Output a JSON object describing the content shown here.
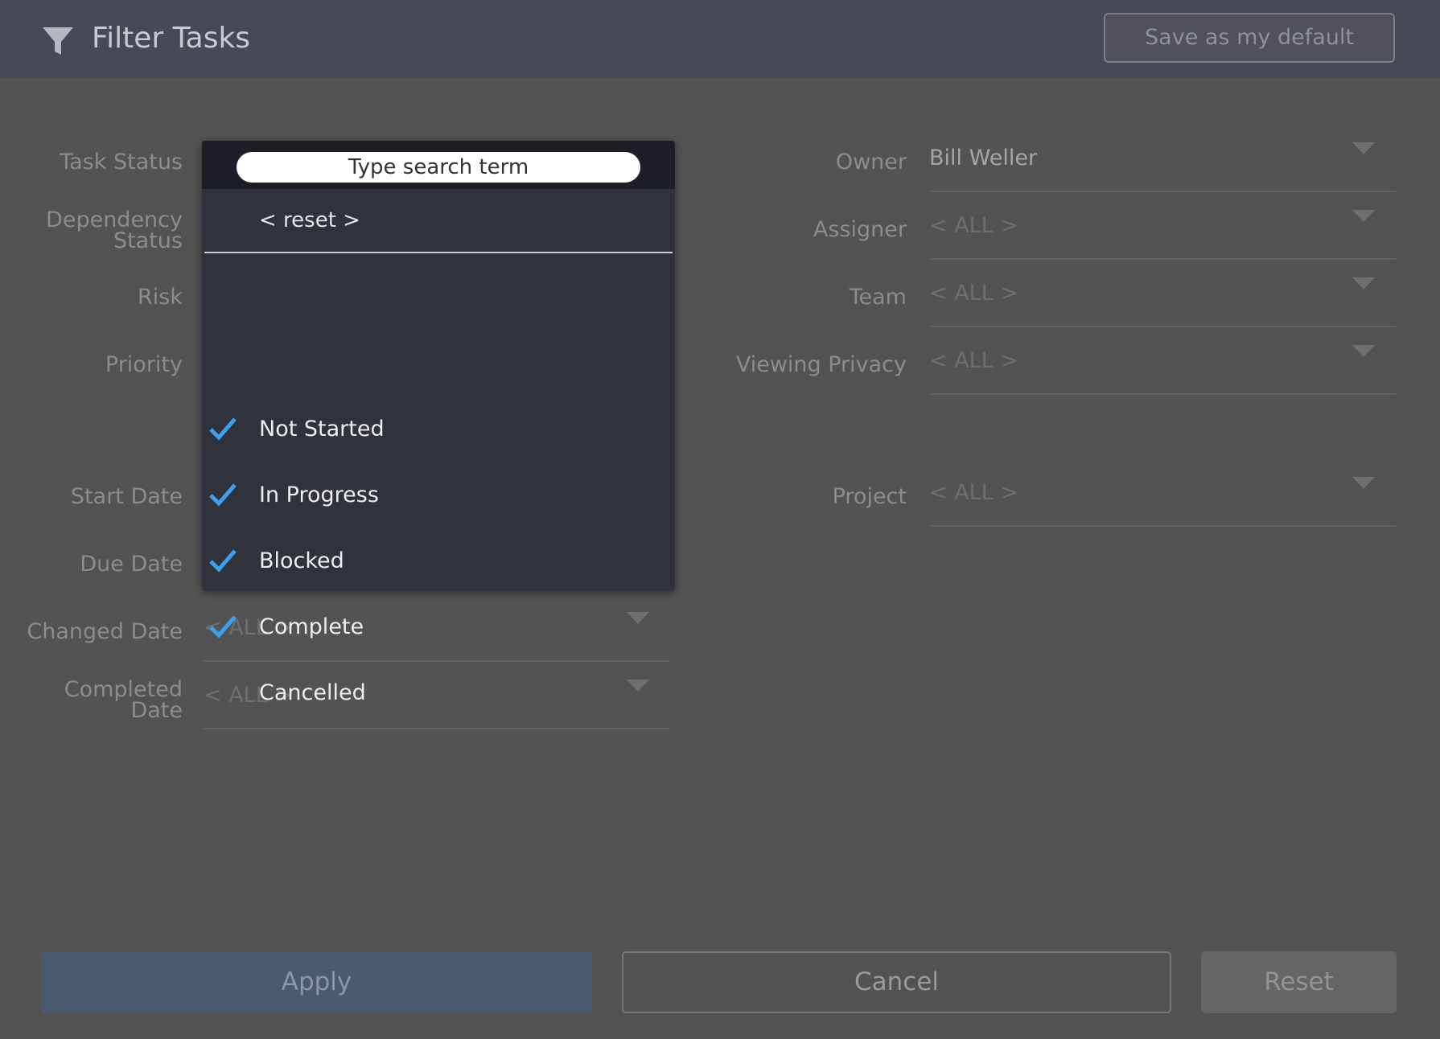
{
  "header": {
    "title": "Filter Tasks",
    "save_default_label": "Save as my default",
    "icon": "filter-icon"
  },
  "left_labels": {
    "task_status": "Task Status",
    "dependency_status_1": "Dependency",
    "dependency_status_2": "Status",
    "risk": "Risk",
    "priority": "Priority",
    "start_date": "Start Date",
    "due_date": "Due Date",
    "changed_date": "Changed Date",
    "completed_date_1": "Completed",
    "completed_date_2": "Date"
  },
  "left_fields": {
    "changed_date": "< ALL >",
    "completed_date": "< ALL >"
  },
  "right_fields": {
    "owner": {
      "label": "Owner",
      "value": "Bill Weller"
    },
    "assigner": {
      "label": "Assigner",
      "value": "< ALL >"
    },
    "team": {
      "label": "Team",
      "value": "< ALL >"
    },
    "viewing_privacy": {
      "label": "Viewing Privacy",
      "value": "< ALL >"
    },
    "project": {
      "label": "Project",
      "value": "< ALL >"
    }
  },
  "dropdown": {
    "search_placeholder": "Type search term",
    "reset_label": "< reset >",
    "items": [
      {
        "label": "Not Started",
        "checked": true
      },
      {
        "label": "In Progress",
        "checked": true
      },
      {
        "label": "Blocked",
        "checked": true
      },
      {
        "label": "Complete",
        "checked": true
      },
      {
        "label": "Cancelled",
        "checked": false
      }
    ],
    "check_color": "#3aa0f0"
  },
  "footer": {
    "apply_label": "Apply",
    "cancel_label": "Cancel",
    "reset_label": "Reset"
  }
}
